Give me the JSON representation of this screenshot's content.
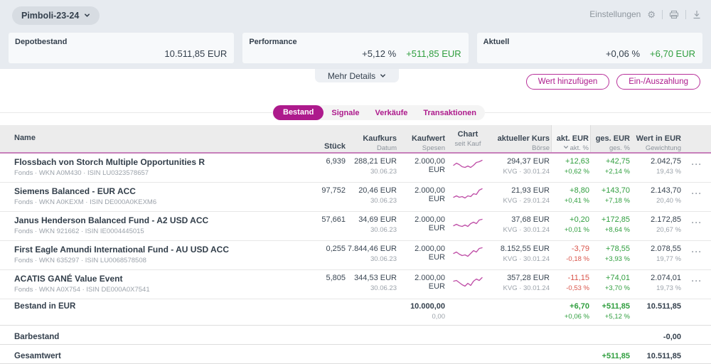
{
  "colors": {
    "accent": "#ad1a8c",
    "green": "#2f9e3e",
    "red": "#d9544a",
    "spark": "#c050a8",
    "dark": "#333f4c"
  },
  "header": {
    "portfolio_name": "Pimboli-23-24",
    "settings_label": "Einstellungen"
  },
  "summary": {
    "more_details_label": "Mehr Details",
    "cards": [
      {
        "label": "Depotbestand",
        "value": "10.511,85 EUR",
        "value_style": "dark"
      },
      {
        "label": "Performance",
        "pct": "+5,12 %",
        "value": "+511,85 EUR",
        "value_style": "green"
      },
      {
        "label": "Aktuell",
        "pct": "+0,06 %",
        "value": "+6,70 EUR",
        "value_style": "green"
      }
    ]
  },
  "actions": {
    "add_value": "Wert hinzufügen",
    "deposit": "Ein-/Auszahlung"
  },
  "tabs": [
    {
      "label": "Bestand",
      "active": true
    },
    {
      "label": "Signale",
      "active": false
    },
    {
      "label": "Verkäufe",
      "active": false
    },
    {
      "label": "Transaktionen",
      "active": false
    }
  ],
  "table": {
    "columns": [
      {
        "l1": "Name",
        "l2": ""
      },
      {
        "l1": "Stück",
        "l2": ""
      },
      {
        "l1": "Kaufkurs",
        "l2": "Datum"
      },
      {
        "l1": "Kaufwert",
        "l2": "Spesen"
      },
      {
        "l1": "Chart",
        "l2": "seit Kauf"
      },
      {
        "l1": "aktueller Kurs",
        "l2": "Börse"
      },
      {
        "l1": "akt. EUR",
        "l2": "akt. %",
        "sorted": true
      },
      {
        "l1": "ges. EUR",
        "l2": "ges. %"
      },
      {
        "l1": "Wert in EUR",
        "l2": "Gewichtung"
      }
    ],
    "rows": [
      {
        "name": "Flossbach von Storch Multiple Opportunities R",
        "sub": "Fonds · WKN A0M430 · ISIN LU0323578657",
        "stueck": "6,939",
        "kaufkurs": "288,21 EUR",
        "datum": "30.06.23",
        "kaufwert": "2.000,00 EUR",
        "spesen": "",
        "kurs": "294,37 EUR",
        "boerse": "KVG · 30.01.24",
        "akt_eur": "+12,63",
        "akt_pct": "+0,62 %",
        "ges_eur": "+42,75",
        "ges_pct": "+2,14 %",
        "wert": "2.042,75",
        "gewichtung": "19,43 %",
        "spark": [
          9,
          6,
          8,
          11,
          12,
          10,
          12,
          9,
          5,
          4,
          2
        ]
      },
      {
        "name": "Siemens Balanced - EUR ACC",
        "sub": "Fonds · WKN A0KEXM · ISIN DE000A0KEXM6",
        "stueck": "97,752",
        "kaufkurs": "20,46 EUR",
        "datum": "30.06.23",
        "kaufwert": "2.000,00 EUR",
        "spesen": "",
        "kurs": "21,93 EUR",
        "boerse": "KVG · 29.01.24",
        "akt_eur": "+8,80",
        "akt_pct": "+0,41 %",
        "ges_eur": "+143,70",
        "ges_pct": "+7,18 %",
        "wert": "2.143,70",
        "gewichtung": "20,40 %",
        "spark": [
          13,
          11,
          13,
          12,
          14,
          11,
          12,
          8,
          9,
          3,
          1
        ]
      },
      {
        "name": "Janus Henderson Balanced Fund - A2 USD ACC",
        "sub": "Fonds · WKN 921662 · ISIN IE0004445015",
        "stueck": "57,661",
        "kaufkurs": "34,69 EUR",
        "datum": "30.06.23",
        "kaufwert": "2.000,00 EUR",
        "spesen": "",
        "kurs": "37,68 EUR",
        "boerse": "KVG · 30.01.24",
        "akt_eur": "+0,20",
        "akt_pct": "+0,01 %",
        "ges_eur": "+172,85",
        "ges_pct": "+8,64 %",
        "wert": "2.172,85",
        "gewichtung": "20,67 %",
        "spark": [
          12,
          10,
          12,
          13,
          11,
          13,
          9,
          7,
          9,
          4,
          3
        ]
      },
      {
        "name": "First Eagle Amundi International Fund - AU USD ACC",
        "sub": "Fonds · WKN 635297 · ISIN LU0068578508",
        "stueck": "0,255",
        "kaufkurs": "7.844,46 EUR",
        "datum": "30.06.23",
        "kaufwert": "2.000,00 EUR",
        "spesen": "",
        "kurs": "8.152,55 EUR",
        "boerse": "KVG · 30.01.24",
        "akt_eur": "-3,79",
        "akt_pct": "-0,18 %",
        "ges_eur": "+78,55",
        "ges_pct": "+3,93 %",
        "wert": "2.078,55",
        "gewichtung": "19,77 %",
        "spark": [
          10,
          8,
          11,
          13,
          12,
          14,
          10,
          6,
          8,
          3,
          2
        ]
      },
      {
        "name": "ACATIS GANÉ Value Event",
        "sub": "Fonds · WKN A0X754 · ISIN DE000A0X7541",
        "stueck": "5,805",
        "kaufkurs": "344,53 EUR",
        "datum": "30.06.23",
        "kaufwert": "2.000,00 EUR",
        "spesen": "",
        "kurs": "357,28 EUR",
        "boerse": "KVG · 30.01.24",
        "akt_eur": "-11,15",
        "akt_pct": "-0,53 %",
        "ges_eur": "+74,01",
        "ges_pct": "+3,70 %",
        "wert": "2.074,01",
        "gewichtung": "19,73 %",
        "spark": [
          8,
          7,
          10,
          13,
          15,
          11,
          14,
          8,
          5,
          7,
          3
        ]
      }
    ],
    "footer": [
      {
        "type": "tall",
        "label": "Bestand in EUR",
        "kaufwert": "10.000,00",
        "spesen": "0,00",
        "akt_eur": "+6,70",
        "akt_pct": "+0,06 %",
        "ges_eur": "+511,85",
        "ges_pct": "+5,12 %",
        "wert": "10.511,85"
      },
      {
        "type": "slim",
        "label": "Barbestand",
        "wert": "-0,00"
      },
      {
        "type": "slim",
        "label": "Gesamtwert",
        "ges_eur": "+511,85",
        "wert": "10.511,85"
      }
    ]
  }
}
